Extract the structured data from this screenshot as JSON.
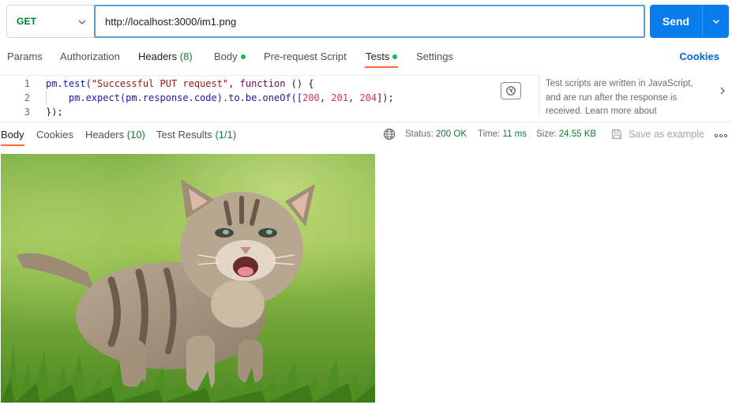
{
  "request": {
    "method": "GET",
    "url": "http://localhost:3000/im1.png",
    "send_label": "Send"
  },
  "request_tabs": [
    {
      "label": "Params"
    },
    {
      "label": "Authorization"
    },
    {
      "label": "Headers",
      "count": "(8)"
    },
    {
      "label": "Body",
      "dot": true
    },
    {
      "label": "Pre-request Script"
    },
    {
      "label": "Tests",
      "dot": true,
      "active": true
    },
    {
      "label": "Settings"
    }
  ],
  "cookies_link": "Cookies",
  "editor": {
    "line_numbers": [
      "1",
      "2",
      "3"
    ],
    "lines": {
      "l1_a": "pm.test(",
      "l1_str": "\"Successful PUT request\"",
      "l1_b": ", ",
      "l1_kw": "function",
      "l1_c": " () {",
      "l2_a": "    pm.expect(pm.response.code).to.be.oneOf([",
      "l2_n1": "200",
      "l2_s1": ", ",
      "l2_n2": "201",
      "l2_s2": ", ",
      "l2_n3": "204",
      "l2_b": "]);",
      "l3": "});"
    },
    "hint": "Test scripts are written in JavaScript, and are run after the response is received. Learn more about"
  },
  "response_tabs": [
    {
      "label": "Body",
      "active": true
    },
    {
      "label": "Cookies"
    },
    {
      "label": "Headers",
      "count": "(10)"
    },
    {
      "label": "Test Results",
      "count": "(1/1)"
    }
  ],
  "response_meta": {
    "status_label": "Status:",
    "status_value": "200 OK",
    "time_label": "Time:",
    "time_value": "11 ms",
    "size_label": "Size:",
    "size_value": "24.55 KB",
    "save_label": "Save as example"
  },
  "colors": {
    "accent": "#ff6c37",
    "send": "#097bed",
    "method": "#007f31",
    "success": "#0c7f32"
  },
  "icons": [
    "chevron-down-icon",
    "beautify-icon",
    "chevron-right-icon",
    "globe-icon",
    "save-icon",
    "more-icon"
  ]
}
